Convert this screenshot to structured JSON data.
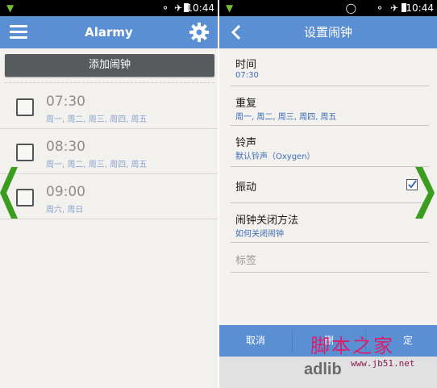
{
  "status_bar": {
    "time": "10:44"
  },
  "left_screen": {
    "title": "Alarmy",
    "add_button": "添加闹钟",
    "alarms": [
      {
        "time": "07:30",
        "days": "周一, 周二, 周三, 周四, 周五",
        "checked": false
      },
      {
        "time": "08:30",
        "days": "周一, 周二, 周三, 周四, 周五",
        "checked": false
      },
      {
        "time": "09:00",
        "days": "周六, 周日",
        "checked": false
      }
    ]
  },
  "right_screen": {
    "title": "设置闹钟",
    "rows": [
      {
        "title": "时间",
        "value": "07:30"
      },
      {
        "title": "重复",
        "value": "周一, 周二, 周三, 周四, 周五"
      },
      {
        "title": "铃声",
        "value": "默认铃声（Oxygen）"
      },
      {
        "title": "振动",
        "checked": true
      },
      {
        "title": "闹钟关闭方法",
        "value": "如何关闭闹钟"
      }
    ],
    "label_placeholder": "标签",
    "footer": {
      "cancel": "取消",
      "middle": "删",
      "right": "定"
    }
  },
  "watermark": {
    "site_cn": "脚本之家",
    "site_url": "www.jb51.net",
    "adlib": "adlib"
  },
  "colors": {
    "app_bar": "#5b8fd4",
    "accent_text": "#3c6cb5",
    "arrow": "#3a9d1e",
    "add_button": "#585b5e"
  }
}
